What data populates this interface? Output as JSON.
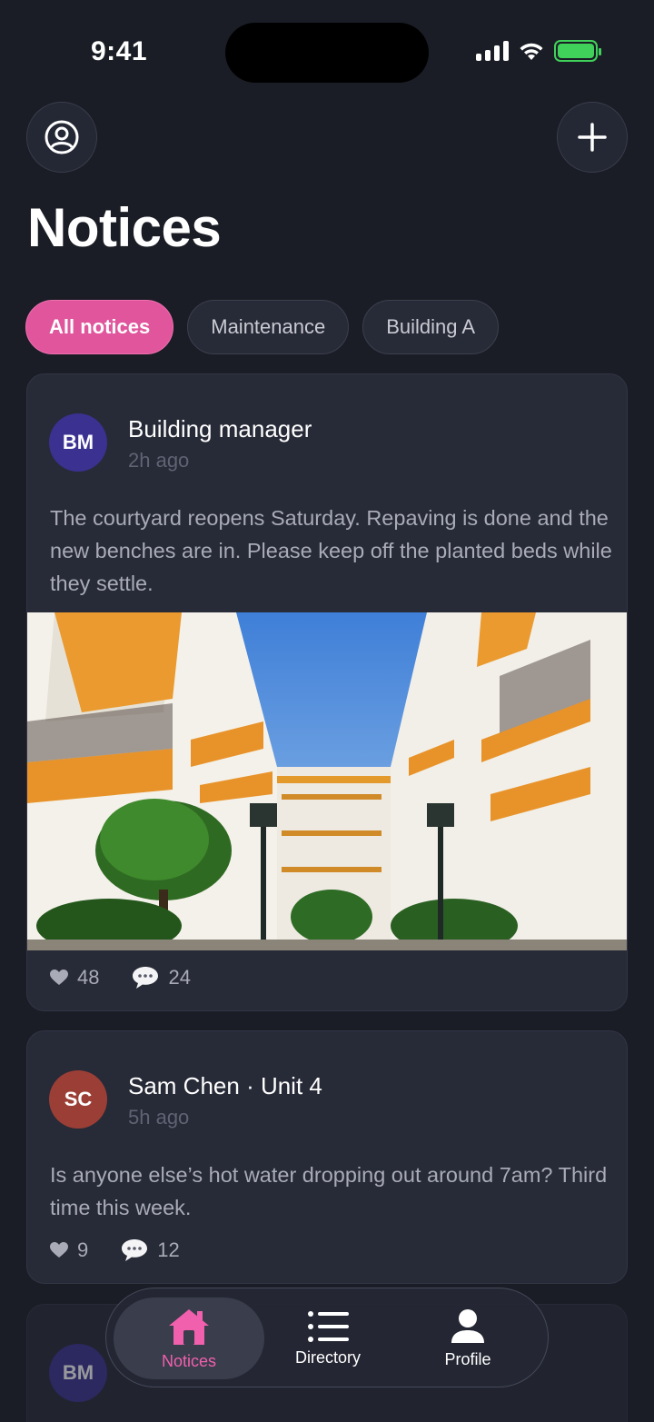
{
  "status": {
    "time": "9:41"
  },
  "header": {
    "title": "Notices"
  },
  "filters": [
    "All notices",
    "Maintenance",
    "Building A"
  ],
  "notices": [
    {
      "initials": "BM",
      "author": "Building manager",
      "time": "2h ago",
      "body": "The courtyard reopens Saturday. Repaving is done and the new benches are in. Please keep off the planted beds while they settle.",
      "likes": "48",
      "comments": "24"
    },
    {
      "initials": "SC",
      "author": "Sam Chen · Unit 4",
      "time": "5h ago",
      "body": "Is anyone else’s hot water dropping out around 7am? Third time this week.",
      "likes": "9",
      "comments": "12"
    },
    {
      "initials": "BM",
      "author": "",
      "time": ""
    }
  ],
  "tabs": {
    "notices": "Notices",
    "directory": "Directory",
    "profile": "Profile"
  },
  "colors": {
    "accent": "#e0559c",
    "background": "#1b1d26",
    "card": "#272a37",
    "battery": "#3fd15a"
  }
}
